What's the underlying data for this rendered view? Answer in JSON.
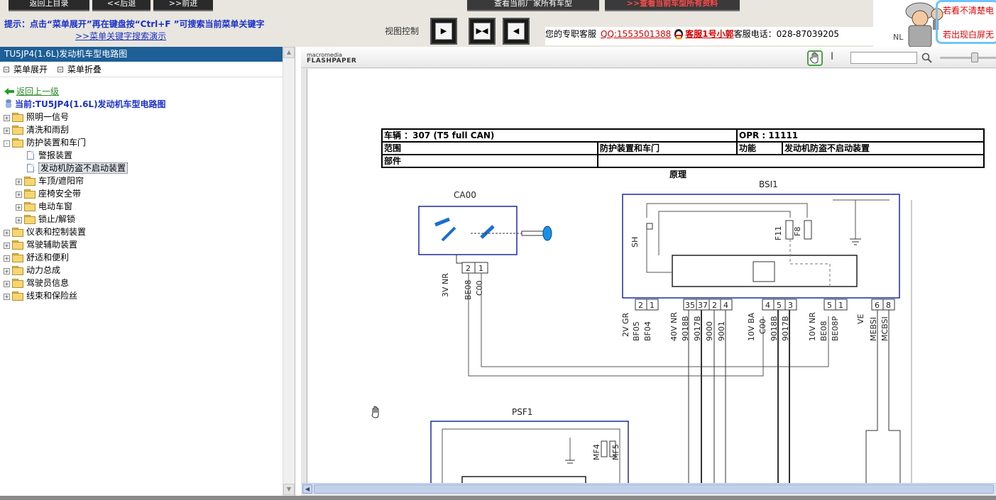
{
  "top": {
    "buttons": [
      {
        "label": "返回上目录"
      },
      {
        "label": "<<后退"
      },
      {
        "label": ">>前进"
      },
      {
        "label": "查看当前厂家所有车型"
      },
      {
        "label": ">>查看当前车型所有资料"
      }
    ],
    "hint_line1": "提示：点击“菜单展开”再在键盘按“Ctrl+F ”可搜索当前菜单关键字",
    "hint_line2": ">>菜单关键字搜索演示",
    "view_control_label": "视图控制",
    "view_buttons": [
      "▶",
      "▶◀",
      "◀"
    ],
    "service": {
      "label": "您的专职客服",
      "qq": "QQ:1553501388",
      "agent": "客服1号小郭",
      "phone_label": "客服电话：",
      "phone": "028-87039205"
    },
    "nl_text": "NL",
    "hint_unclear": "若看不清楚电",
    "hint_white": "若出现白屏无"
  },
  "sidebar": {
    "header": "TU5JP4(1.6L)发动机车型电路图",
    "menu_expand": "菜单展开",
    "menu_collapse": "菜单折叠",
    "back_label": "返回上一级",
    "current_label": "当前:TU5JP4(1.6L)发动机车型电路图",
    "tree": [
      {
        "label": "照明一信号",
        "level": 0,
        "type": "folder",
        "exp": "+"
      },
      {
        "label": "清洗和雨刮",
        "level": 0,
        "type": "folder",
        "exp": "+"
      },
      {
        "label": "防护装置和车门",
        "level": 0,
        "type": "folder",
        "exp": "-"
      },
      {
        "label": "警报装置",
        "level": 1,
        "type": "doc"
      },
      {
        "label": "发动机防盗不启动装置",
        "level": 1,
        "type": "doc",
        "selected": true
      },
      {
        "label": "车顶/遮阳帘",
        "level": 1,
        "type": "folder",
        "exp": "+"
      },
      {
        "label": "座椅安全带",
        "level": 1,
        "type": "folder",
        "exp": "+"
      },
      {
        "label": "电动车窗",
        "level": 1,
        "type": "folder",
        "exp": "+"
      },
      {
        "label": "锁止/解锁",
        "level": 1,
        "type": "folder",
        "exp": "+"
      },
      {
        "label": "仪表和控制装置",
        "level": 0,
        "type": "folder",
        "exp": "+"
      },
      {
        "label": "驾驶辅助装置",
        "level": 0,
        "type": "folder",
        "exp": "+"
      },
      {
        "label": "舒适和便利",
        "level": 0,
        "type": "folder",
        "exp": "+"
      },
      {
        "label": "动力总成",
        "level": 0,
        "type": "folder",
        "exp": "+"
      },
      {
        "label": "驾驶员信息",
        "level": 0,
        "type": "folder",
        "exp": "+"
      },
      {
        "label": "线束和保险丝",
        "level": 0,
        "type": "folder",
        "exp": "+"
      }
    ]
  },
  "viewer": {
    "logo_top": "macromedia",
    "logo_brand": "FLASHPAPER",
    "text_tool": "I"
  },
  "document": {
    "vehicle": "车辆 ：307 (T5 full CAN)",
    "opr": "OPR : 11111",
    "range_label": "范围",
    "range_value": "防护装置和车门",
    "function_label": "功能",
    "function_value": "发动机防盗不启动装置",
    "part_label": "部件",
    "principle": "原理"
  },
  "diagram": {
    "components": [
      "CA00",
      "BSI1",
      "PSF1"
    ],
    "ca00_pins": [
      "2",
      "1"
    ],
    "ca00_wires": [
      "3V NR",
      "BE08",
      "C00"
    ],
    "bsi_fuses": [
      "F11",
      "F8"
    ],
    "bsi_relay": "SH",
    "bsi_pins": [
      "2",
      "1",
      "35",
      "37",
      "2",
      "4",
      "4",
      "5",
      "3",
      "5",
      "1",
      "6",
      "8"
    ],
    "bsi_wires": [
      "2V GR",
      "BF05",
      "BF04",
      "40V NR",
      "9018B",
      "9017B",
      "9000",
      "9001",
      "10V BA",
      "C00",
      "9018B",
      "9017B",
      "10V NR",
      "BE08",
      "BE08P",
      "VE",
      "MEBSI",
      "MCBSI"
    ],
    "psf_fuses": [
      "MF4",
      "MF5"
    ]
  }
}
